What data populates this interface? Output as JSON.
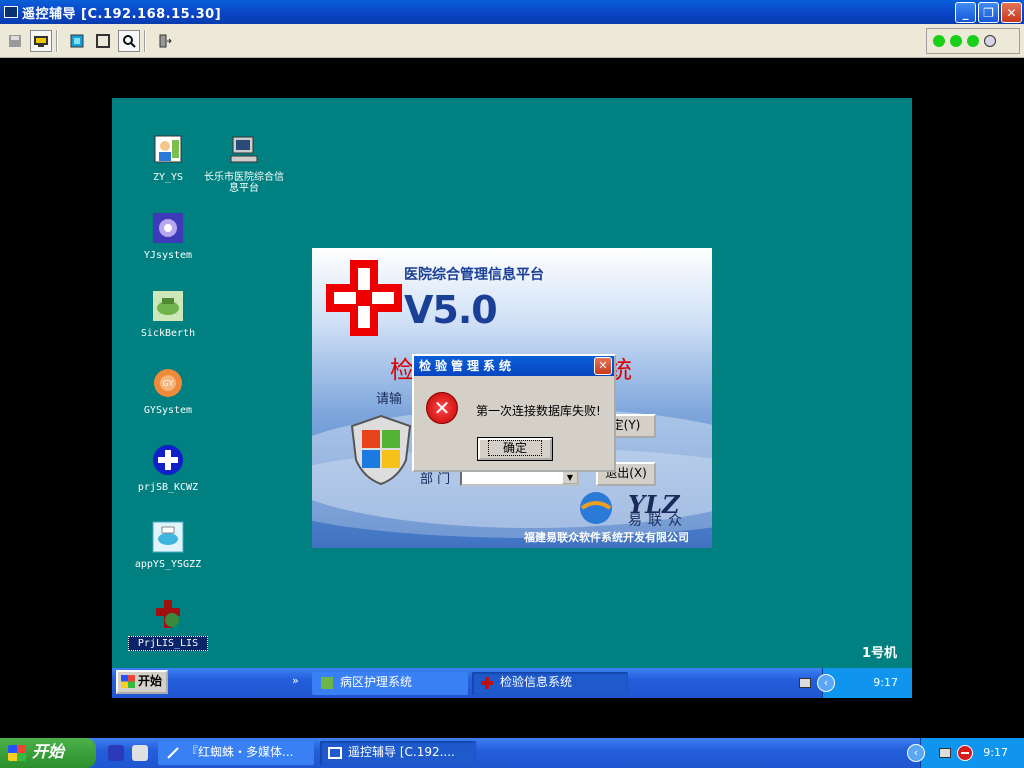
{
  "window": {
    "title": "遥控辅导 [C.192.168.15.30]",
    "buttons": [
      "minimize",
      "restore",
      "close"
    ]
  },
  "toolbar": {
    "icons": [
      "save-icon",
      "remote-control-icon",
      "fullscreen-icon",
      "window-icon",
      "zoom-icon",
      "exit-icon"
    ],
    "status_dots": [
      "#19d019",
      "#19d019",
      "#19d019"
    ]
  },
  "desktop": {
    "background": "#008080",
    "icons": [
      {
        "label": "ZY_YS"
      },
      {
        "label": "长乐市医院综合信息平台"
      },
      {
        "label": "YJsystem"
      },
      {
        "label": "SickBerth"
      },
      {
        "label": "GYSystem"
      },
      {
        "label": "prjSB_KCWZ"
      },
      {
        "label": "appYS_YSGZZ"
      },
      {
        "label": "PrjLIS_LIS"
      }
    ]
  },
  "splash": {
    "title": "医院综合管理信息平台",
    "version": "V5.0",
    "system_left": "检",
    "system_right": "统",
    "prompt": "请输",
    "dept_label": "部 门",
    "confirm_label": "定(Y)",
    "exit_label": "退出(X)",
    "logo": "YLZ",
    "logo_cn": "易联众",
    "company": "福建易联众软件系统开发有限公司"
  },
  "dialog": {
    "title": "检验管理系统",
    "message": "第一次连接数据库失败!",
    "ok_label": "确定"
  },
  "remote_taskbar": {
    "start_label": "开始",
    "chevron": "»",
    "tasks": [
      {
        "label": "病区护理系统"
      },
      {
        "label": "检验信息系统"
      }
    ],
    "clock": "9:17",
    "machine_label": "1号机"
  },
  "local_taskbar": {
    "start_label": "开始",
    "tasks": [
      {
        "label": "『红蜘蛛・多媒体..."
      },
      {
        "label": "遥控辅导 [C.192...."
      }
    ],
    "clock": "9:17"
  }
}
